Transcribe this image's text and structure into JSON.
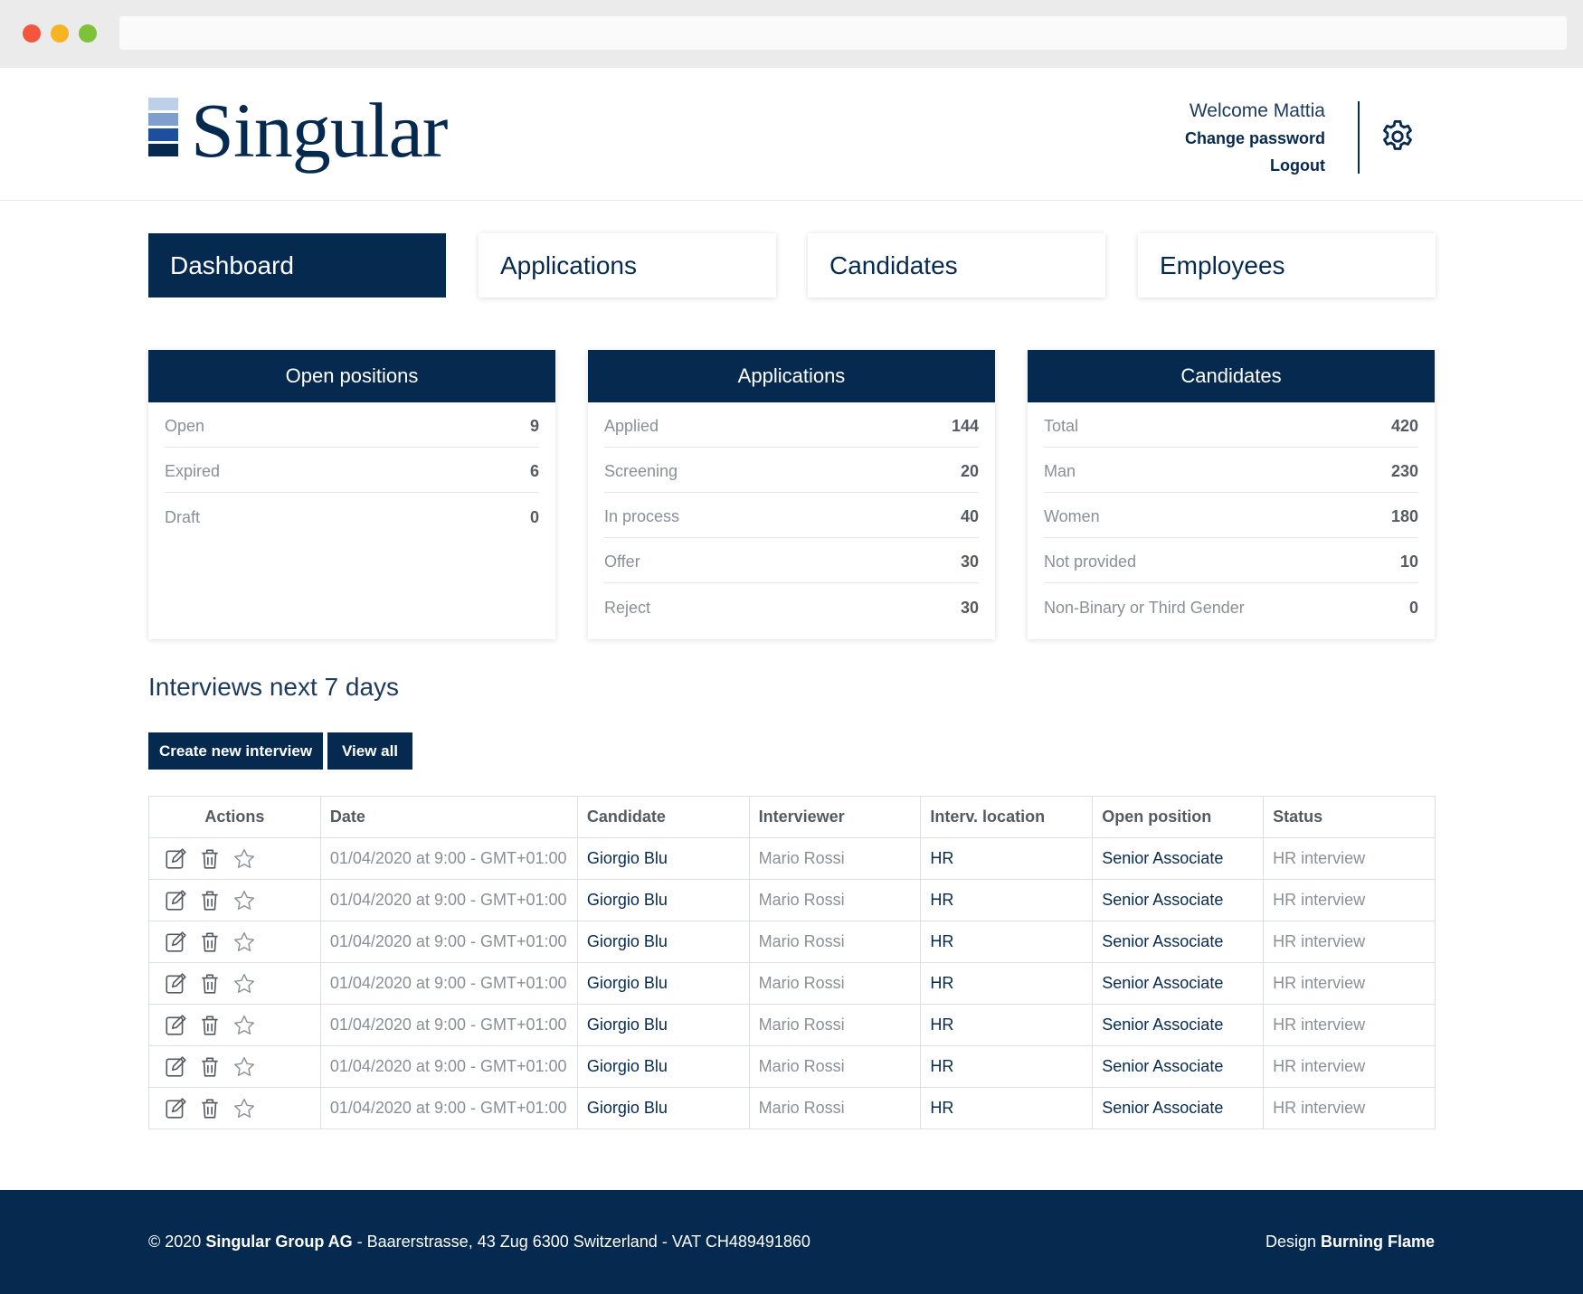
{
  "brand": {
    "name": "Singular",
    "mark_colors": [
      "#bcd0e8",
      "#7f9fcf",
      "#1e4f9c",
      "#062a4f"
    ]
  },
  "user": {
    "welcome": "Welcome Mattia",
    "change_password": "Change password",
    "logout": "Logout",
    "settings_icon": "gear-icon"
  },
  "nav": {
    "tabs": [
      {
        "label": "Dashboard",
        "active": true
      },
      {
        "label": "Applications",
        "active": false
      },
      {
        "label": "Candidates",
        "active": false
      },
      {
        "label": "Employees",
        "active": false
      }
    ]
  },
  "cards": [
    {
      "title": "Open positions",
      "rows": [
        {
          "label": "Open",
          "value": "9"
        },
        {
          "label": "Expired",
          "value": "6"
        },
        {
          "label": "Draft",
          "value": "0"
        }
      ]
    },
    {
      "title": "Applications",
      "rows": [
        {
          "label": "Applied",
          "value": "144"
        },
        {
          "label": "Screening",
          "value": "20"
        },
        {
          "label": "In process",
          "value": "40"
        },
        {
          "label": "Offer",
          "value": "30"
        },
        {
          "label": "Reject",
          "value": "30"
        }
      ]
    },
    {
      "title": "Candidates",
      "rows": [
        {
          "label": "Total",
          "value": "420"
        },
        {
          "label": "Man",
          "value": "230"
        },
        {
          "label": "Women",
          "value": "180"
        },
        {
          "label": "Not provided",
          "value": "10"
        },
        {
          "label": "Non-Binary or Third Gender",
          "value": "0"
        }
      ]
    }
  ],
  "interviews": {
    "title": "Interviews next 7 days",
    "create_button": "Create new interview",
    "view_all_button": "View all",
    "columns": [
      "Actions",
      "Date",
      "Candidate",
      "Interviewer",
      "Interv. location",
      "Open position",
      "Status"
    ],
    "action_icons": [
      "edit-icon",
      "trash-icon",
      "star-icon"
    ],
    "rows": [
      {
        "date": "01/04/2020 at 9:00 - GMT+01:00",
        "candidate": "Giorgio Blu",
        "interviewer": "Mario Rossi",
        "location": "HR",
        "position": "Senior Associate",
        "status": "HR interview"
      },
      {
        "date": "01/04/2020 at 9:00 - GMT+01:00",
        "candidate": "Giorgio Blu",
        "interviewer": "Mario Rossi",
        "location": "HR",
        "position": "Senior Associate",
        "status": "HR interview"
      },
      {
        "date": "01/04/2020 at 9:00 - GMT+01:00",
        "candidate": "Giorgio Blu",
        "interviewer": "Mario Rossi",
        "location": "HR",
        "position": "Senior Associate",
        "status": "HR interview"
      },
      {
        "date": "01/04/2020 at 9:00 - GMT+01:00",
        "candidate": "Giorgio Blu",
        "interviewer": "Mario Rossi",
        "location": "HR",
        "position": "Senior Associate",
        "status": "HR interview"
      },
      {
        "date": "01/04/2020 at 9:00 - GMT+01:00",
        "candidate": "Giorgio Blu",
        "interviewer": "Mario Rossi",
        "location": "HR",
        "position": "Senior Associate",
        "status": "HR interview"
      },
      {
        "date": "01/04/2020 at 9:00 - GMT+01:00",
        "candidate": "Giorgio Blu",
        "interviewer": "Mario Rossi",
        "location": "HR",
        "position": "Senior Associate",
        "status": "HR interview"
      },
      {
        "date": "01/04/2020 at 9:00 - GMT+01:00",
        "candidate": "Giorgio Blu",
        "interviewer": "Mario Rossi",
        "location": "HR",
        "position": "Senior Associate",
        "status": "HR interview"
      }
    ]
  },
  "footer": {
    "copyright_prefix": "© 2020 ",
    "company": "Singular Group AG",
    "address": " - Baarerstrasse, 43 Zug 6300 Switzerland - VAT CH489491860",
    "design_prefix": "Design ",
    "designer": "Burning Flame"
  },
  "colors": {
    "navy": "#062a4f",
    "grey_text": "#8a8f96",
    "border": "#dcdfe3"
  }
}
